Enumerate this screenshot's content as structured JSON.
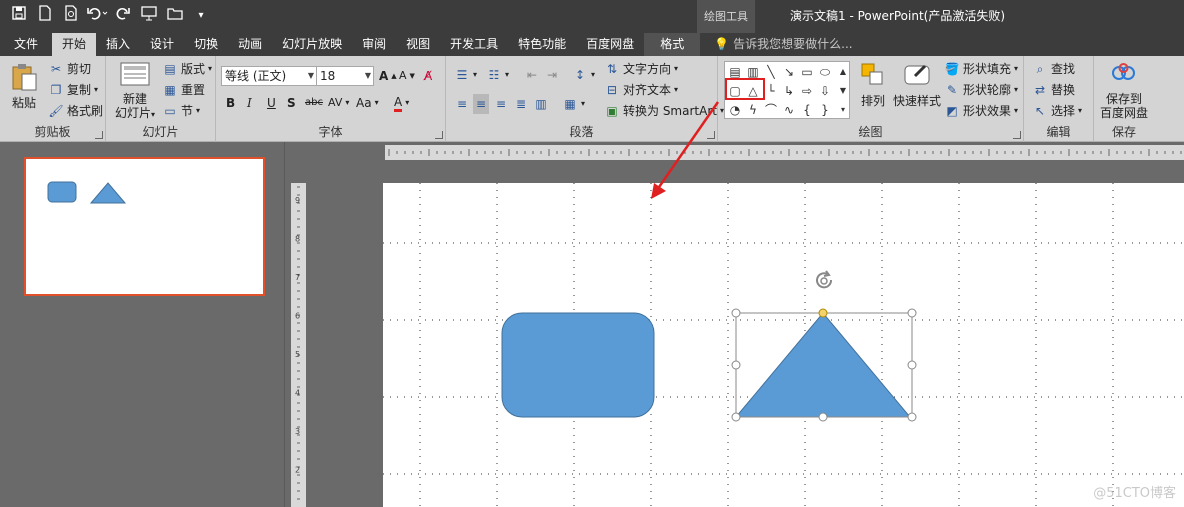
{
  "colors": {
    "accent": "#d04a2a",
    "shape_fill": "#5b9bd5",
    "shape_stroke": "#41719c",
    "title_bg": "#3c3c3c",
    "ribbon_bg": "#d4d4d4",
    "highlight": "#e02020"
  },
  "qat": {
    "icons": [
      "save-icon",
      "new-file-icon",
      "print-preview-icon",
      "undo-icon",
      "redo-icon",
      "slideshow-icon",
      "open-icon",
      "customize-icon"
    ]
  },
  "titlebar": {
    "context_tab": "绘图工具",
    "title": "演示文稿1 - PowerPoint(产品激活失败)"
  },
  "tabs": [
    "文件",
    "开始",
    "插入",
    "设计",
    "切换",
    "动画",
    "幻灯片放映",
    "审阅",
    "视图",
    "开发工具",
    "特色功能",
    "百度网盘",
    "格式"
  ],
  "active_tab": "开始",
  "tellme": {
    "placeholder": "告诉我您想要做什么..."
  },
  "clipboard": {
    "paste": "粘贴",
    "cut": "剪切",
    "copy": "复制",
    "format_painter": "格式刷",
    "label": "剪贴板"
  },
  "slides_group": {
    "new_slide": "新建",
    "new_slide2": "幻灯片",
    "layout": "版式",
    "reset": "重置",
    "section": "节",
    "label": "幻灯片"
  },
  "font_group": {
    "font_name": "等线 (正文)",
    "font_size": "18",
    "label": "字体",
    "bold": "B",
    "italic": "I",
    "underline": "U",
    "shadow": "S",
    "strike": "abc",
    "spacing": "AV",
    "case": "Aa",
    "color": "A"
  },
  "paragraph_group": {
    "text_direction": "文字方向",
    "align_text": "对齐文本",
    "smartart": "转换为 SmartArt",
    "label": "段落"
  },
  "drawing_group": {
    "arrange": "排列",
    "quick_styles": "快速样式",
    "shape_fill": "形状填充",
    "shape_outline": "形状轮廓",
    "shape_effects": "形状效果",
    "label": "绘图"
  },
  "editing_group": {
    "find": "查找",
    "replace": "替换",
    "select": "选择",
    "label": "编辑"
  },
  "save_group": {
    "save_to": "保存到",
    "baidu": "百度网盘",
    "label": "保存"
  },
  "ruler": {
    "v_ticks": [
      "9",
      "8",
      "7",
      "6",
      "5",
      "4",
      "3",
      "2"
    ]
  },
  "watermark": "@51CTO博客"
}
